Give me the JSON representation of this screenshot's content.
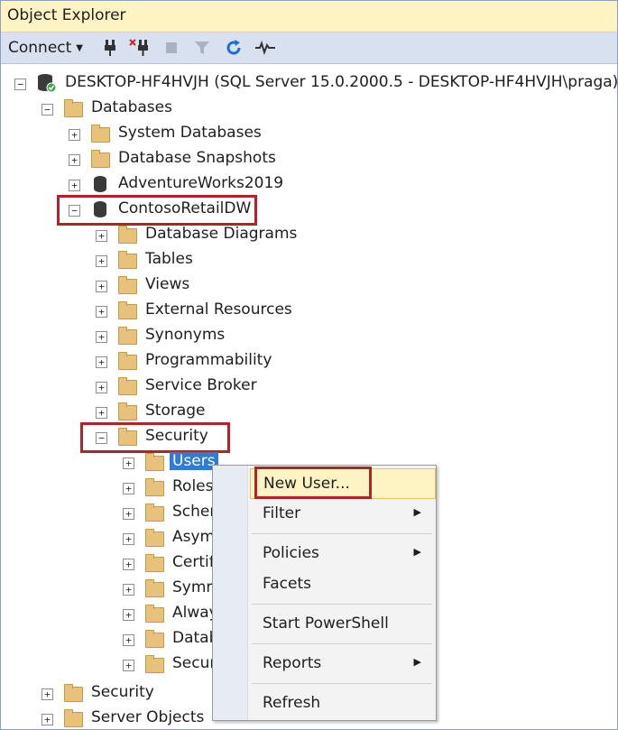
{
  "window": {
    "title": "Object Explorer"
  },
  "toolbar": {
    "connect_label": "Connect",
    "icons": [
      "connect-plug-icon",
      "disconnect-plug-icon",
      "stop-icon",
      "filter-icon",
      "refresh-icon",
      "activity-monitor-icon"
    ]
  },
  "tree": {
    "server": "DESKTOP-HF4HVJH (SQL Server 15.0.2000.5 - DESKTOP-HF4HVJH\\praga)",
    "databases": "Databases",
    "system_databases": "System Databases",
    "database_snapshots": "Database Snapshots",
    "adventureworks": "AdventureWorks2019",
    "contoso": "ContosoRetailDW",
    "contoso_children": [
      "Database Diagrams",
      "Tables",
      "Views",
      "External Resources",
      "Synonyms",
      "Programmability",
      "Service Broker",
      "Storage"
    ],
    "security": "Security",
    "security_children": [
      "Users",
      "Roles",
      "Scher",
      "Asym",
      "Certif",
      "Symm",
      "Alway",
      "Datab",
      "Secur"
    ],
    "root_security": "Security",
    "server_objects": "Server Objects"
  },
  "context_menu": {
    "new_user": "New User...",
    "filter": "Filter",
    "policies": "Policies",
    "facets": "Facets",
    "start_powershell": "Start PowerShell",
    "reports": "Reports",
    "refresh": "Refresh"
  },
  "colors": {
    "title_bar": "#fdf3c3",
    "toolbar": "#d8e1ef",
    "highlight_box": "#b32227",
    "selection": "#2f7bd6",
    "refresh_icon": "#1e6fc9",
    "folder": "#e8c27a"
  }
}
